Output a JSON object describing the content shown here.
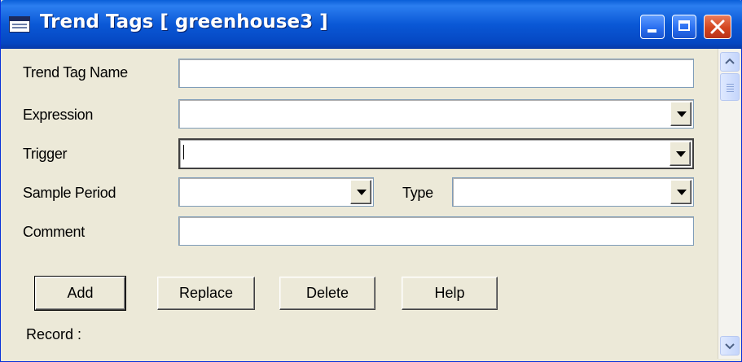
{
  "window": {
    "title": "Trend Tags [ greenhouse3 ]"
  },
  "form": {
    "trend_tag_name": {
      "label": "Trend Tag Name",
      "value": ""
    },
    "expression": {
      "label": "Expression",
      "value": ""
    },
    "trigger": {
      "label": "Trigger",
      "value": ""
    },
    "sample_period": {
      "label": "Sample Period",
      "value": ""
    },
    "type": {
      "label": "Type",
      "value": ""
    },
    "comment": {
      "label": "Comment",
      "value": ""
    }
  },
  "buttons": {
    "add": "Add",
    "replace": "Replace",
    "delete": "Delete",
    "help": "Help"
  },
  "status": {
    "record_label": "Record :"
  },
  "icons": {
    "app": "trend-tags-app-icon",
    "minimize": "minimize-icon",
    "maximize": "maximize-icon",
    "close": "close-icon",
    "dropdown": "chevron-down-icon"
  },
  "colors": {
    "titlebar": "#0a58d6",
    "close": "#d4451e",
    "background": "#ece9d8"
  }
}
